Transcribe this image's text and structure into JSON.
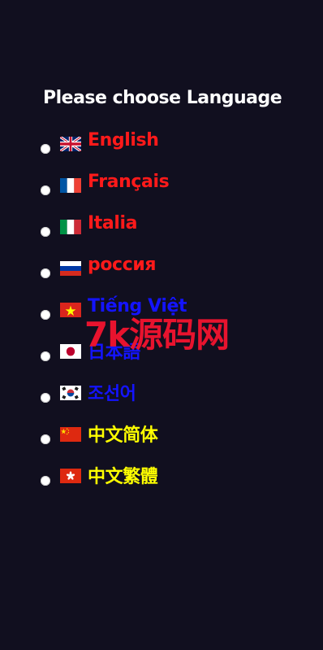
{
  "title": "Please choose Language",
  "colors": {
    "background": "#110f1f",
    "title": "#ffffff",
    "watermark": "#e8132e"
  },
  "languages": [
    {
      "label": "English",
      "flag": "uk-flag-icon",
      "color": "#ff1a1a"
    },
    {
      "label": "Français",
      "flag": "france-flag-icon",
      "color": "#ff1a1a"
    },
    {
      "label": "Italia",
      "flag": "italy-flag-icon",
      "color": "#ff1a1a"
    },
    {
      "label": "россия",
      "flag": "russia-flag-icon",
      "color": "#ff1a1a"
    },
    {
      "label": "Tiếng Việt",
      "flag": "vietnam-flag-icon",
      "color": "#1414ff"
    },
    {
      "label": "日本語",
      "flag": "japan-flag-icon",
      "color": "#1414ff"
    },
    {
      "label": "조선어",
      "flag": "korea-flag-icon",
      "color": "#1414ff"
    },
    {
      "label": "中文简体",
      "flag": "china-flag-icon",
      "color": "#ffff00"
    },
    {
      "label": "中文繁體",
      "flag": "hongkong-flag-icon",
      "color": "#ffff00"
    }
  ],
  "watermark": "7k源码网"
}
